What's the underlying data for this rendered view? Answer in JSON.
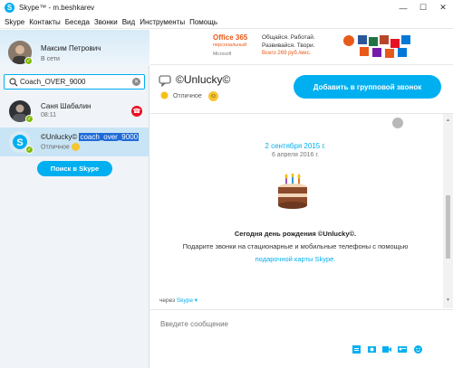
{
  "window": {
    "title": "Skype™ - m.beshkarev",
    "controls": [
      "—",
      "☐",
      "✕"
    ]
  },
  "menu": [
    "Skype",
    "Контакты",
    "Беседа",
    "Звонки",
    "Вид",
    "Инструменты",
    "Помощь"
  ],
  "profile": {
    "name": "Максим Петрович",
    "status": "В сети"
  },
  "search": {
    "value": "Coach_OVER_9000"
  },
  "contacts": [
    {
      "name": "Саня Шабалин",
      "sub": "08:11"
    },
    {
      "name": "©Unlucky©",
      "selected_handle": "coach_over_9000",
      "sub": "Отличное"
    }
  ],
  "search_skype_label": "Поиск в Skype",
  "ad": {
    "product": "Office 365",
    "product_sub": "персональный",
    "vendor": "Microsoft",
    "line1": "Общайся. Работай.",
    "line2": "Развивайся. Твори.",
    "price": "Всего 269 руб./мес."
  },
  "conversation": {
    "contact_name": "©Unlucky©",
    "mood": "Отличное",
    "add_call_label": "Добавить в групповой звонок",
    "date_label": "2 сентября 2015 г.",
    "date_label_2": "6 апреля 2016 г.",
    "birthday_title": "Сегодня день рождения ©Unlucky©.",
    "birthday_text": "Подарите звонки на стационарные и мобильные телефоны с помощью",
    "birthday_link": "подарочной карты Skype.",
    "via_label": "через",
    "via_service": "Skype ▾",
    "compose_placeholder": "Введите сообщение"
  },
  "colors": {
    "accent": "#00aff0",
    "online": "#7fba00",
    "hangup": "#e81123",
    "selected_row": "#c9e5f5"
  },
  "icons": [
    "skype-icon",
    "search-icon",
    "clear-icon",
    "hangup-icon",
    "chat-icon",
    "globe-icon",
    "smiley-icon",
    "cake-icon",
    "file-icon",
    "photo-icon",
    "video-message-icon",
    "contact-card-icon",
    "emoticon-icon"
  ]
}
